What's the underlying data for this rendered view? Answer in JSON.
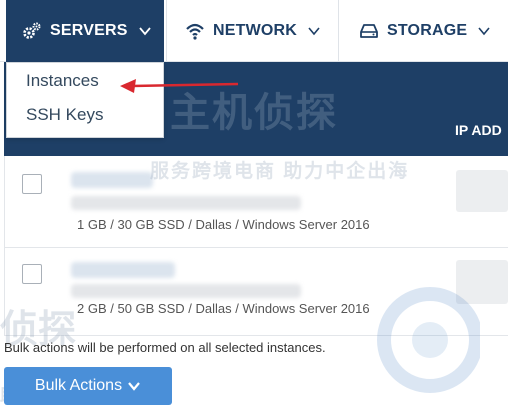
{
  "colors": {
    "nav_active_bg": "#1e3f66",
    "nav_text": "#1e3f66",
    "table_header_bg": "#1e3f66",
    "button_bg": "#4a8fd8",
    "annotation_arrow": "#d9282f"
  },
  "nav": {
    "tabs": [
      {
        "label": "SERVERS",
        "icon": "gears-icon",
        "active": true
      },
      {
        "label": "NETWORK",
        "icon": "wifi-icon",
        "active": false
      },
      {
        "label": "STORAGE",
        "icon": "hard-drive-icon",
        "active": false
      }
    ]
  },
  "servers_menu": {
    "items": [
      {
        "label": "Instances"
      },
      {
        "label": "SSH Keys"
      }
    ]
  },
  "table": {
    "columns": {
      "ip": "IP ADD"
    },
    "rows": [
      {
        "specs": "1 GB / 30 GB SSD / Dallas / Windows Server 2016"
      },
      {
        "specs": "2 GB / 50 GB SSD / Dallas / Windows Server 2016"
      }
    ]
  },
  "watermark": {
    "big": "主机侦探",
    "small": "服务跨境电商 助力中企出海",
    "bottom_big": "侦探",
    "bottom_small": "助力中企出海"
  },
  "footer": {
    "bulk_note": "Bulk actions will be performed on all selected instances.",
    "bulk_button": "Bulk Actions"
  }
}
